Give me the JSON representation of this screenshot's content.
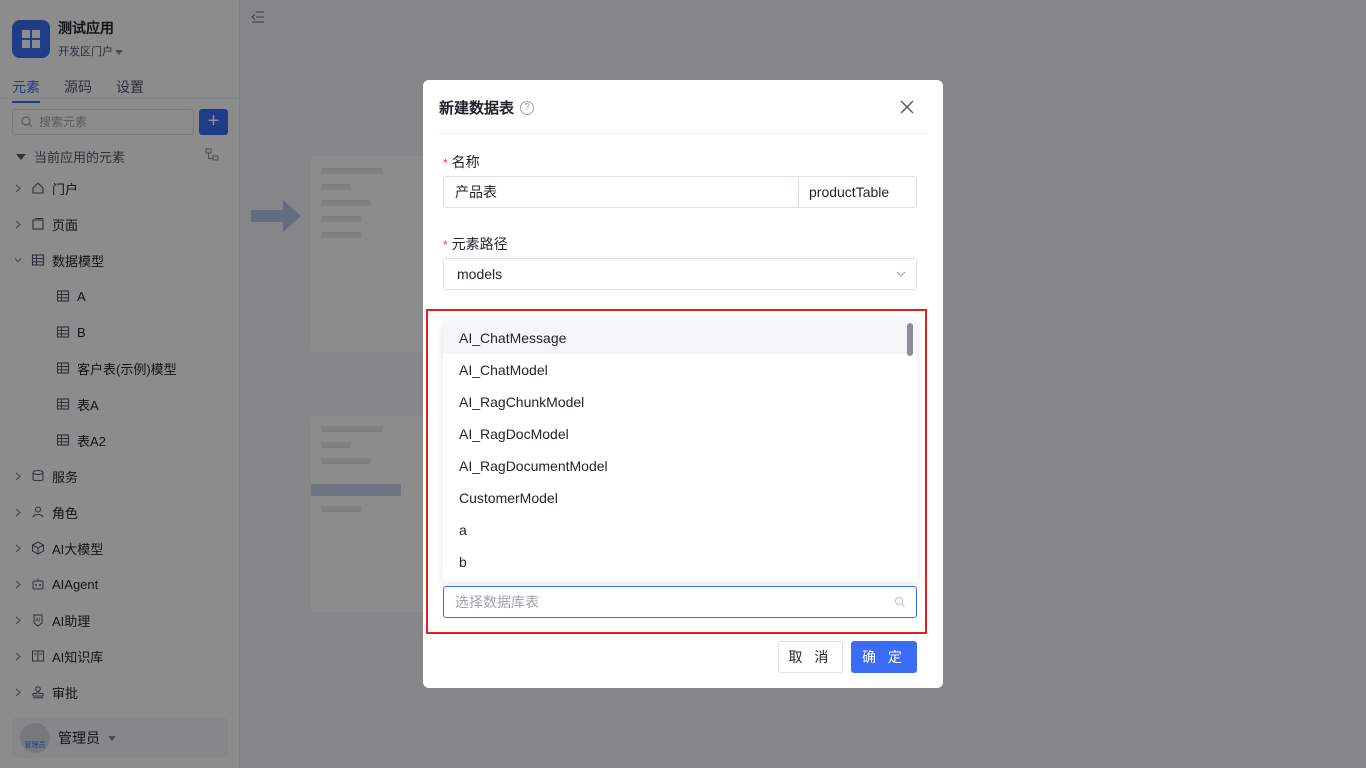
{
  "app": {
    "name": "测试应用",
    "portal": "开发区门户"
  },
  "tabs": [
    {
      "label": "元素"
    },
    {
      "label": "源码"
    },
    {
      "label": "设置"
    }
  ],
  "search": {
    "placeholder": "搜索元素"
  },
  "tree": {
    "root_label": "当前应用的元素",
    "items": [
      {
        "label": "门户"
      },
      {
        "label": "页面"
      },
      {
        "label": "数据模型"
      },
      {
        "label": "A"
      },
      {
        "label": "B"
      },
      {
        "label": "客户表(示例)模型"
      },
      {
        "label": "表A"
      },
      {
        "label": "表A2"
      },
      {
        "label": "服务"
      },
      {
        "label": "角色"
      },
      {
        "label": "AI大模型"
      },
      {
        "label": "AIAgent"
      },
      {
        "label": "AI助理"
      },
      {
        "label": "AI知识库"
      },
      {
        "label": "审批"
      }
    ]
  },
  "user": {
    "name": "管理员",
    "avatar_text": "管理员"
  },
  "dialog": {
    "title": "新建数据表",
    "name_label": "名称",
    "name_value": "产品表",
    "name_code": "productTable",
    "path_label": "元素路径",
    "path_value": "models",
    "options": [
      {
        "label": "AI_ChatMessage"
      },
      {
        "label": "AI_ChatModel"
      },
      {
        "label": "AI_RagChunkModel"
      },
      {
        "label": "AI_RagDocModel"
      },
      {
        "label": "AI_RagDocumentModel"
      },
      {
        "label": "CustomerModel"
      },
      {
        "label": "a"
      },
      {
        "label": "b"
      }
    ],
    "db_placeholder": "选择数据库表",
    "cancel_label": "取 消",
    "ok_label": "确 定"
  },
  "colors": {
    "accent": "#3b6cf6",
    "highlight": "#e02020",
    "required": "#f53f3f"
  }
}
